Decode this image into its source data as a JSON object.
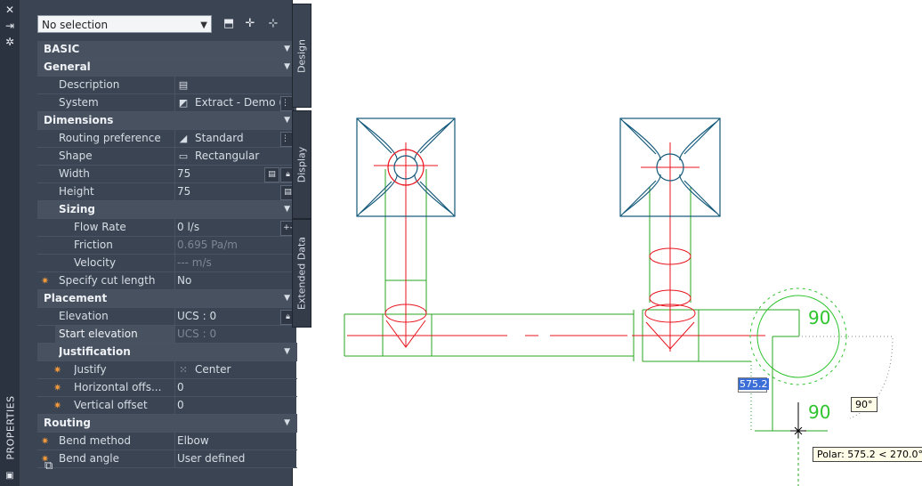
{
  "strip": {
    "close_glyph": "✕",
    "pin_glyph": "⇥",
    "settings_glyph": "✲",
    "title": "PROPERTIES"
  },
  "toolbar": {
    "selection": "No selection"
  },
  "tabs": {
    "design": "Design",
    "display": "Display",
    "extended": "Extended Data"
  },
  "categories": {
    "basic": "BASIC",
    "general": "General",
    "dimensions": "Dimensions",
    "sizing": "Sizing",
    "placement": "Placement",
    "justification": "Justification",
    "routing": "Routing"
  },
  "props": {
    "description": {
      "label": "Description",
      "value": ""
    },
    "system": {
      "label": "System",
      "value": "Extract - Demo (E..."
    },
    "routing_pref": {
      "label": "Routing preference",
      "value": "Standard"
    },
    "shape": {
      "label": "Shape",
      "value": "Rectangular"
    },
    "width": {
      "label": "Width",
      "value": "75"
    },
    "height": {
      "label": "Height",
      "value": "75"
    },
    "flow_rate": {
      "label": "Flow Rate",
      "value": "0 l/s"
    },
    "friction": {
      "label": "Friction",
      "value": "0.695 Pa/m"
    },
    "velocity": {
      "label": "Velocity",
      "value": "--- m/s"
    },
    "cut_length": {
      "label": "Specify cut length",
      "value": "No"
    },
    "elevation": {
      "label": "Elevation",
      "value": "UCS : 0"
    },
    "start_elevation": {
      "label": "Start elevation",
      "value": "UCS : 0"
    },
    "justify": {
      "label": "Justify",
      "value": "Center"
    },
    "horiz_offset": {
      "label": "Horizontal offs...",
      "value": "0"
    },
    "vert_offset": {
      "label": "Vertical offset",
      "value": "0"
    },
    "bend_method": {
      "label": "Bend method",
      "value": "Elbow"
    },
    "bend_angle": {
      "label": "Bend angle",
      "value": "User defined"
    }
  },
  "canvas": {
    "angle_label_top": "90",
    "angle_label_bottom": "90",
    "dyn_input": "575.2",
    "angle_tip": "90°",
    "polar_tip": "Polar: 575.2 < 270.0°"
  },
  "colors": {
    "duct": "#2aa61f",
    "center": "#e8141e",
    "diffuser": "#14587a",
    "panel": "#3b4453",
    "accent": "#3c6ed8"
  }
}
